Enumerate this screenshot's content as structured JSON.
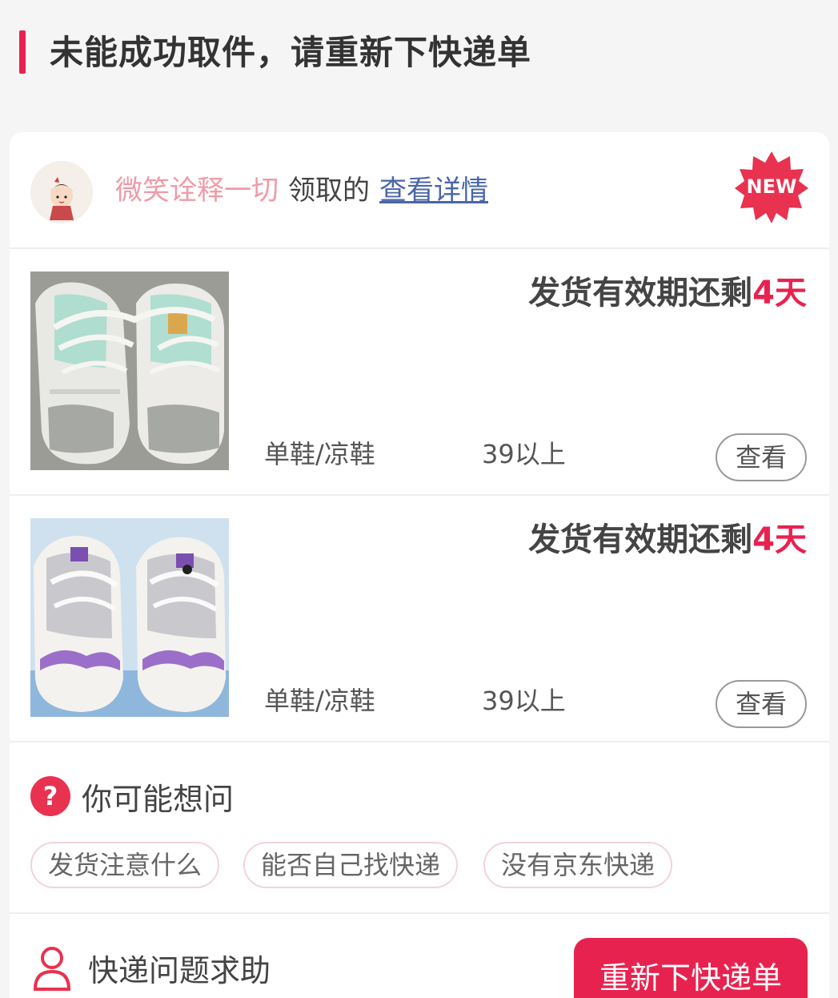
{
  "header": {
    "title": "未能成功取件，请重新下快递单",
    "accent": "#e8224f"
  },
  "receiver": {
    "name": "微笑诠释一切",
    "action": "领取的",
    "link": "查看详情",
    "badge": "NEW"
  },
  "items": [
    {
      "deadline_prefix": "发货有效期还剩",
      "deadline_days": "4天",
      "category": "单鞋/凉鞋",
      "size": "39以上",
      "view_label": "查看",
      "photo_icon": "white-sneakers-photo"
    },
    {
      "deadline_prefix": "发货有效期还剩",
      "deadline_days": "4天",
      "category": "单鞋/凉鞋",
      "size": "39以上",
      "view_label": "查看",
      "photo_icon": "glitter-sneakers-photo"
    }
  ],
  "faq": {
    "title": "你可能想问",
    "chips": [
      "发货注意什么",
      "能否自己找快递",
      "没有京东快递"
    ]
  },
  "help": {
    "text": "快递问题求助",
    "button": "重新下快递单"
  }
}
